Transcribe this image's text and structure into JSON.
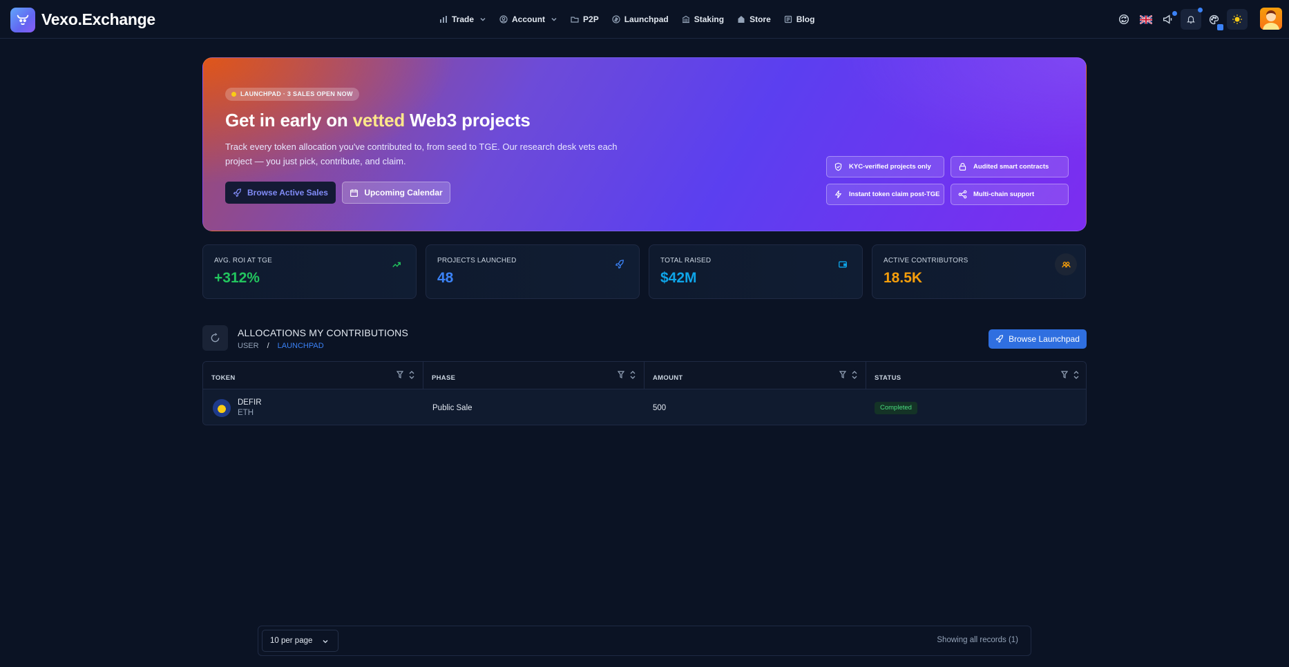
{
  "brand": {
    "name": "Vexo.Exchange"
  },
  "nav": {
    "items": [
      {
        "label": "Trade",
        "icon": "chart-bar-icon",
        "dropdown": true
      },
      {
        "label": "Account",
        "icon": "users-icon",
        "dropdown": true
      },
      {
        "label": "P2P",
        "icon": "folder-icon",
        "dropdown": false
      },
      {
        "label": "Launchpad",
        "icon": "coin-icon",
        "dropdown": false
      },
      {
        "label": "Staking",
        "icon": "bank-icon",
        "dropdown": false
      },
      {
        "label": "Store",
        "icon": "store-icon",
        "dropdown": false
      },
      {
        "label": "Blog",
        "icon": "newspaper-icon",
        "dropdown": false
      }
    ]
  },
  "hero": {
    "badge": "LAUNCHPAD · 3 SALES OPEN NOW",
    "title_pre": "Get in early on ",
    "title_highlight": "vetted",
    "title_post": " Web3 projects",
    "description": "Track every token allocation you've contributed to, from seed to TGE. Our research desk vets each project — you just pick, contribute, and claim.",
    "primary_button": "Browse Active Sales",
    "secondary_button": "Upcoming Calendar",
    "features": [
      {
        "label": "KYC-verified projects only",
        "icon": "shield-check-icon"
      },
      {
        "label": "Audited smart contracts",
        "icon": "lock-icon"
      },
      {
        "label": "Instant token claim post-TGE",
        "icon": "bolt-icon"
      },
      {
        "label": "Multi-chain support",
        "icon": "network-icon"
      }
    ]
  },
  "stats": [
    {
      "label": "AVG. ROI AT TGE",
      "value": "+312%",
      "color": "#22c55e",
      "icon": "trending-up-icon"
    },
    {
      "label": "PROJECTS LAUNCHED",
      "value": "48",
      "color": "#3b82f6",
      "icon": "rocket-icon"
    },
    {
      "label": "TOTAL RAISED",
      "value": "$42M",
      "color": "#0ea5e9",
      "icon": "wallet-icon"
    },
    {
      "label": "ACTIVE CONTRIBUTORS",
      "value": "18.5K",
      "color": "#f59e0b",
      "icon": "users-icon"
    }
  ],
  "section": {
    "title": "ALLOCATIONS MY CONTRIBUTIONS",
    "breadcrumb": [
      "USER",
      "/",
      "LAUNCHPAD"
    ],
    "action_button": "Browse Launchpad"
  },
  "table": {
    "columns": [
      "TOKEN",
      "PHASE",
      "AMOUNT",
      "STATUS"
    ],
    "rows": [
      {
        "token": "DEFIR",
        "chain": "ETH",
        "phase": "Public Sale",
        "amount": "500",
        "status": "Completed"
      }
    ]
  },
  "pagination": {
    "per_page": "10 per page",
    "records": "Showing all records (1)"
  },
  "colors": {
    "background": "#0b1324",
    "accent": "#2f6fe0",
    "highlight": "#fde68a"
  }
}
